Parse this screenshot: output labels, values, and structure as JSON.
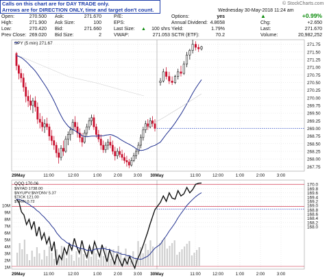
{
  "note": {
    "line1": "Calls on this chart are for DAY TRADE only.",
    "line2": "Arrows are for DIRECTION ONLY, time and target don't count."
  },
  "header": {
    "date": "Wednesday  30-May-2018  11:24 am",
    "brand": "© StockCharts.com",
    "rows": [
      {
        "l1": "Open:",
        "v1": "270.500",
        "l2": "Ask:",
        "v2": "271.670",
        "l3": "P/E:",
        "v3": "",
        "l4": "Options:",
        "v4": "yes",
        "l5": "",
        "v5": "+0.99%"
      },
      {
        "l1": "High:",
        "v1": "271.900",
        "l2": "Ask Size:",
        "v2": "100",
        "l3": "EPS:",
        "v3": "",
        "l4": "Annual Dividend:",
        "v4": "4.8658",
        "l5": "Chg:",
        "v5": "+2.650"
      },
      {
        "l1": "Low:",
        "v1": "270.420",
        "l2": "Bid:",
        "v2": "271.660",
        "l3": "Last Size:",
        "v3": "100 shrs",
        "l4": "Yield:",
        "v4": "1.79%",
        "l5": "Last:",
        "v5": "271.670"
      },
      {
        "l1": "Prev Close:",
        "v1": "269.020",
        "l2": "Bid Size:",
        "v2": "2",
        "l3": "VWAP:",
        "v3": "271.053",
        "l4": "SCTR (ETF):",
        "v4": "70.2",
        "l5": "Volume:",
        "v5": "20,982,252"
      }
    ]
  },
  "colors": {
    "up": "#111111",
    "down": "#c8102e",
    "ma": "#1f2f8f",
    "red_line": "#c8102e",
    "blue_line": "#2a49c9",
    "grid": "#cfcfcf"
  },
  "chart_data": [
    {
      "type": "candlestick",
      "title": "SPY (5 min) 271.67",
      "ylim": [
        267.6,
        271.9
      ],
      "yticks": [
        271.75,
        271.5,
        271.25,
        271.0,
        270.75,
        270.5,
        270.25,
        270.0,
        269.75,
        269.5,
        269.25,
        269.0,
        268.75,
        268.5,
        268.25,
        268.0,
        267.75
      ],
      "xtick_labels": [
        "29May",
        "11:00",
        "12:00",
        "1:00",
        "2:00",
        "3:00",
        "30May",
        "11:00",
        "12:00",
        "1:00",
        "2:00",
        "3:00"
      ],
      "ohlc_29may": [
        [
          271.45,
          271.5,
          270.9,
          271.05
        ],
        [
          271.05,
          271.1,
          270.6,
          270.8
        ],
        [
          270.8,
          270.95,
          270.5,
          270.65
        ],
        [
          270.65,
          270.8,
          270.2,
          270.35
        ],
        [
          270.35,
          270.5,
          269.85,
          270.05
        ],
        [
          270.05,
          270.25,
          269.7,
          269.9
        ],
        [
          269.9,
          270.1,
          269.6,
          269.75
        ],
        [
          269.75,
          270.0,
          269.5,
          269.9
        ],
        [
          269.9,
          270.05,
          269.55,
          269.7
        ],
        [
          269.7,
          269.85,
          269.15,
          269.3
        ],
        [
          269.3,
          269.5,
          269.0,
          269.2
        ],
        [
          269.2,
          269.4,
          268.9,
          269.05
        ],
        [
          269.05,
          269.3,
          268.85,
          269.15
        ],
        [
          269.15,
          269.35,
          268.95,
          269.05
        ],
        [
          269.05,
          269.15,
          268.6,
          268.75
        ],
        [
          268.75,
          268.95,
          268.45,
          268.6
        ],
        [
          268.6,
          268.75,
          268.3,
          268.45
        ],
        [
          268.45,
          268.55,
          268.05,
          268.2
        ],
        [
          268.2,
          268.35,
          267.85,
          268.05
        ],
        [
          268.05,
          268.45,
          267.95,
          268.35
        ],
        [
          268.35,
          268.6,
          268.1,
          268.25
        ],
        [
          268.25,
          268.75,
          268.2,
          268.65
        ],
        [
          268.65,
          268.9,
          268.45,
          268.8
        ],
        [
          268.8,
          269.05,
          268.6,
          268.95
        ],
        [
          268.95,
          269.3,
          268.8,
          269.2
        ],
        [
          269.2,
          269.4,
          268.95,
          269.05
        ],
        [
          269.05,
          269.2,
          268.7,
          268.85
        ],
        [
          268.85,
          269.0,
          268.55,
          268.7
        ],
        [
          268.7,
          268.85,
          268.4,
          268.55
        ],
        [
          268.55,
          268.95,
          268.5,
          268.85
        ],
        [
          268.85,
          269.15,
          268.75,
          269.05
        ],
        [
          269.05,
          269.35,
          268.95,
          269.25
        ],
        [
          269.25,
          269.45,
          269.1,
          269.35
        ],
        [
          269.35,
          269.45,
          268.95,
          269.05
        ],
        [
          269.05,
          269.15,
          268.7,
          268.8
        ],
        [
          268.8,
          268.95,
          268.55,
          268.65
        ],
        [
          268.65,
          268.8,
          268.3,
          268.45
        ],
        [
          268.45,
          268.6,
          268.2,
          268.3
        ],
        [
          268.3,
          268.55,
          268.2,
          268.45
        ],
        [
          268.45,
          268.65,
          268.3,
          268.55
        ],
        [
          268.55,
          268.75,
          268.35,
          268.45
        ],
        [
          268.45,
          268.6,
          268.15,
          268.25
        ],
        [
          268.25,
          268.4,
          267.95,
          268.1
        ],
        [
          268.1,
          268.35,
          268.0,
          268.25
        ],
        [
          268.25,
          268.4,
          268.05,
          268.15
        ],
        [
          268.15,
          268.3,
          267.95,
          268.05
        ],
        [
          268.05,
          268.2,
          267.85,
          267.95
        ],
        [
          267.95,
          268.1,
          267.75,
          267.9
        ],
        [
          267.9,
          268.0,
          267.7,
          267.8
        ],
        [
          267.8,
          268.05,
          267.75,
          267.95
        ],
        [
          267.95,
          268.2,
          267.9,
          268.1
        ],
        [
          268.1,
          268.35,
          268.0,
          268.25
        ],
        [
          268.25,
          268.55,
          268.15,
          268.45
        ],
        [
          268.45,
          268.8,
          268.35,
          268.7
        ],
        [
          268.7,
          269.05,
          268.6,
          268.95
        ],
        [
          268.95,
          269.25,
          268.85,
          269.15
        ],
        [
          269.15,
          269.3,
          268.95,
          269.05
        ],
        [
          269.05,
          269.35,
          269.0,
          269.25
        ],
        [
          269.25,
          269.4,
          269.05,
          269.15
        ],
        [
          269.15,
          269.3,
          268.9,
          269.0
        ]
      ],
      "ohlc_30may": [
        [
          270.5,
          270.65,
          270.4,
          270.55
        ],
        [
          270.55,
          270.95,
          270.5,
          270.85
        ],
        [
          270.85,
          271.0,
          270.6,
          270.7
        ],
        [
          270.7,
          270.85,
          270.45,
          270.55
        ],
        [
          270.55,
          270.7,
          270.42,
          270.5
        ],
        [
          270.5,
          270.75,
          270.45,
          270.7
        ],
        [
          270.7,
          270.95,
          270.6,
          270.85
        ],
        [
          270.85,
          271.05,
          270.7,
          270.8
        ],
        [
          270.8,
          271.2,
          270.75,
          271.1
        ],
        [
          271.1,
          271.5,
          271.0,
          271.4
        ],
        [
          271.4,
          271.6,
          271.25,
          271.55
        ],
        [
          271.55,
          271.9,
          271.45,
          271.75
        ],
        [
          271.75,
          271.85,
          271.55,
          271.65
        ],
        [
          271.65,
          271.75,
          271.5,
          271.6
        ],
        [
          271.6,
          271.7,
          271.55,
          271.67
        ]
      ],
      "level_line": 269.0,
      "ma_series": "20-period"
    },
    {
      "type": "line",
      "title": "QQQ 170.06",
      "legend": [
        "$NYAD 1738.00",
        "$NYUPV:$NYDNV 5.37",
        "$TICK 121.00",
        "$TRIN 0.72"
      ],
      "ylim": [
        166.0,
        170.2
      ],
      "yticks": [
        170.0,
        169.8,
        169.6,
        169.4,
        169.2,
        169.0,
        168.8,
        168.6,
        168.4,
        168.2,
        168.0
      ],
      "volume_ticks": [
        "10M",
        "9M",
        "8M",
        "7M",
        "6M",
        "5M",
        "4M",
        "3M",
        "2M",
        "1M"
      ],
      "xtick_labels": [
        "29May",
        "11:00",
        "12:00",
        "1:00",
        "2:00",
        "3:00",
        "30May",
        "11:00",
        "12:00",
        "1:00",
        "2:00",
        "3:00"
      ],
      "level_lines": [
        170.0,
        168.95,
        168.9
      ]
    }
  ]
}
